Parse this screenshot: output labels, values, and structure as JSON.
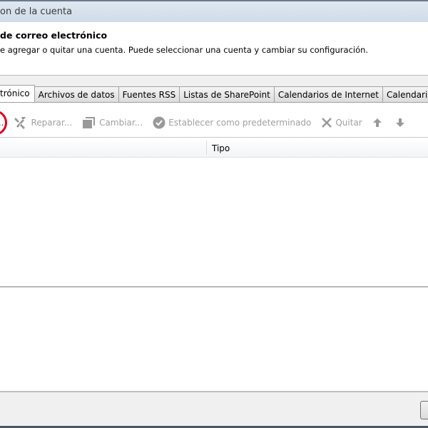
{
  "window": {
    "title": "on de la cuenta"
  },
  "header": {
    "title": "de correo electrónico",
    "description": "e agregar o quitar una cuenta. Puede seleccionar una cuenta y cambiar su configuración."
  },
  "tabs": [
    {
      "label": "trónico",
      "active": true
    },
    {
      "label": "Archivos de datos"
    },
    {
      "label": "Fuentes RSS"
    },
    {
      "label": "Listas de SharePoint"
    },
    {
      "label": "Calendarios de Internet"
    },
    {
      "label": "Calendarios"
    }
  ],
  "toolbar": {
    "new_label": "...",
    "repair_label": "Reparar...",
    "change_label": "Cambiar...",
    "default_label": "Establecer como predeterminado",
    "remove_label": "Quitar"
  },
  "table": {
    "columns": [
      "",
      "Tipo"
    ],
    "rows": []
  },
  "annotation_color": "#e0001a"
}
